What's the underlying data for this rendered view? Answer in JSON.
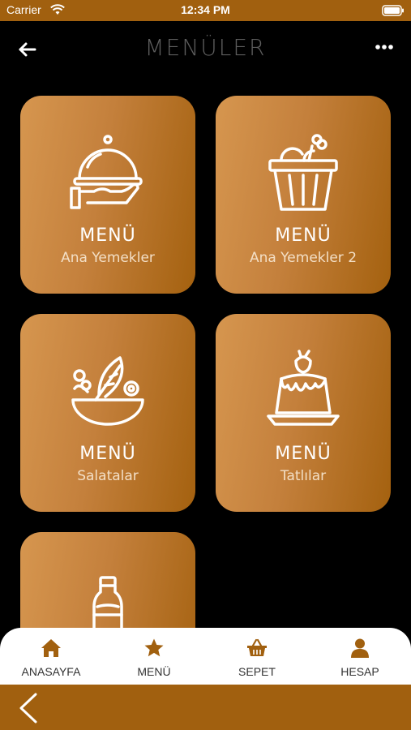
{
  "status_bar": {
    "carrier": "Carrier",
    "time": "12:34 PM"
  },
  "header": {
    "title": "MENÜLER"
  },
  "cards": [
    {
      "title": "MENÜ",
      "subtitle": "Ana Yemekler",
      "icon": "serving-cloche-icon"
    },
    {
      "title": "MENÜ",
      "subtitle": "Ana Yemekler 2",
      "icon": "chicken-bucket-icon"
    },
    {
      "title": "MENÜ",
      "subtitle": "Salatalar",
      "icon": "salad-bowl-icon"
    },
    {
      "title": "MENÜ",
      "subtitle": "Tatlılar",
      "icon": "pudding-dessert-icon"
    },
    {
      "title": "",
      "subtitle": "",
      "icon": "water-bottle-icon"
    }
  ],
  "tab_bar": {
    "items": [
      {
        "label": "ANASAYFA",
        "icon": "home-icon"
      },
      {
        "label": "MENÜ",
        "icon": "star-icon"
      },
      {
        "label": "SEPET",
        "icon": "basket-icon"
      },
      {
        "label": "HESAP",
        "icon": "user-icon"
      }
    ]
  },
  "colors": {
    "accent": "#a1600f",
    "card_light": "#d6964f",
    "background": "#000000",
    "title_gray": "#5d5d5d"
  }
}
